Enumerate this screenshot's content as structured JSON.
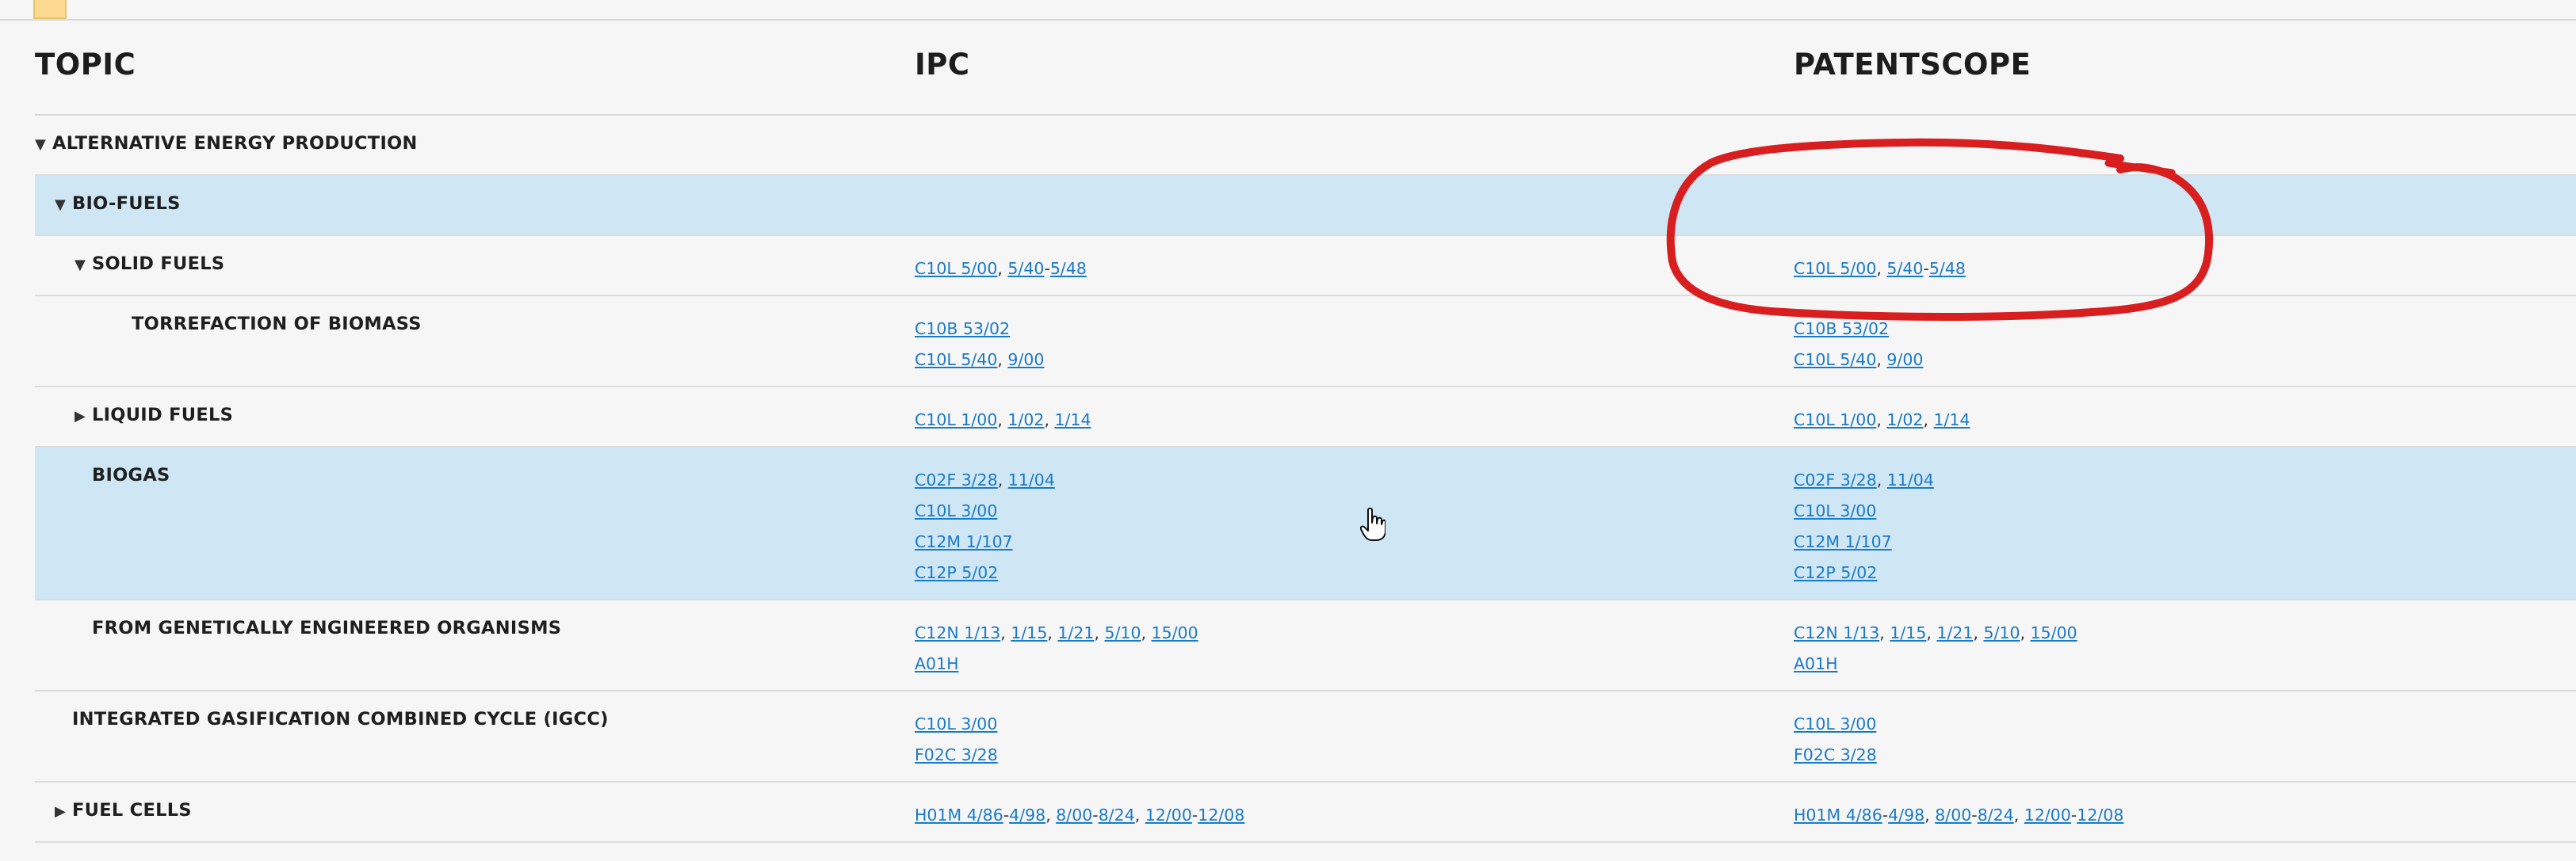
{
  "header": {
    "topic": "TOPIC",
    "ipc": "IPC",
    "patentscope": "PATENTSCOPE"
  },
  "rows": [
    {
      "topic": "ALTERNATIVE ENERGY PRODUCTION",
      "toggle": "▼",
      "level": 0,
      "highlight": false,
      "ipc": [],
      "patentscope": []
    },
    {
      "topic": "BIO-FUELS",
      "toggle": "▼",
      "level": 1,
      "highlight": true,
      "ipc": [],
      "patentscope": []
    },
    {
      "topic": "SOLID FUELS",
      "toggle": "▼",
      "level": 2,
      "highlight": false,
      "ipc": [
        [
          "C10L 5/00",
          ", ",
          "5/40",
          "-",
          "5/48"
        ]
      ],
      "patentscope": [
        [
          "C10L 5/00",
          ", ",
          "5/40",
          "-",
          "5/48"
        ]
      ]
    },
    {
      "topic": "TORREFACTION OF BIOMASS",
      "toggle": "",
      "level": 3,
      "highlight": false,
      "ipc": [
        [
          "C10B 53/02"
        ],
        [
          "C10L 5/40",
          ", ",
          "9/00"
        ]
      ],
      "patentscope": [
        [
          "C10B 53/02"
        ],
        [
          "C10L 5/40",
          ", ",
          "9/00"
        ]
      ]
    },
    {
      "topic": "LIQUID FUELS",
      "toggle": "▶",
      "level": 2,
      "highlight": false,
      "ipc": [
        [
          "C10L 1/00",
          ", ",
          "1/02",
          ", ",
          "1/14"
        ]
      ],
      "patentscope": [
        [
          "C10L 1/00",
          ", ",
          "1/02",
          ", ",
          "1/14"
        ]
      ]
    },
    {
      "topic": "BIOGAS",
      "toggle": "",
      "level": 2,
      "highlight": true,
      "ipc": [
        [
          "C02F 3/28",
          ", ",
          "11/04"
        ],
        [
          "C10L 3/00"
        ],
        [
          "C12M 1/107"
        ],
        [
          "C12P 5/02"
        ]
      ],
      "patentscope": [
        [
          "C02F 3/28",
          ", ",
          "11/04"
        ],
        [
          "C10L 3/00"
        ],
        [
          "C12M 1/107"
        ],
        [
          "C12P 5/02"
        ]
      ]
    },
    {
      "topic": "FROM GENETICALLY ENGINEERED ORGANISMS",
      "toggle": "",
      "level": 2,
      "highlight": false,
      "ipc": [
        [
          "C12N 1/13",
          ", ",
          "1/15",
          ", ",
          "1/21",
          ", ",
          "5/10",
          ", ",
          "15/00"
        ],
        [
          "A01H"
        ]
      ],
      "patentscope": [
        [
          "C12N 1/13",
          ", ",
          "1/15",
          ", ",
          "1/21",
          ", ",
          "5/10",
          ", ",
          "15/00"
        ],
        [
          "A01H"
        ]
      ]
    },
    {
      "topic": "INTEGRATED GASIFICATION COMBINED CYCLE (IGCC)",
      "toggle": "",
      "level": 1,
      "highlight": false,
      "ipc": [
        [
          "C10L 3/00"
        ],
        [
          "F02C 3/28"
        ]
      ],
      "patentscope": [
        [
          "C10L 3/00"
        ],
        [
          "F02C 3/28"
        ]
      ]
    },
    {
      "topic": "FUEL CELLS",
      "toggle": "▶",
      "level": 1,
      "highlight": false,
      "ipc": [
        [
          "H01M 4/86",
          "-",
          "4/98",
          ", ",
          "8/00",
          "-",
          "8/24",
          ", ",
          "12/00",
          "-",
          "12/08"
        ]
      ],
      "patentscope": [
        [
          "H01M 4/86",
          "-",
          "4/98",
          ", ",
          "8/00",
          "-",
          "8/24",
          ", ",
          "12/00",
          "-",
          "12/08"
        ]
      ]
    }
  ],
  "colors": {
    "link": "#1a7ac9",
    "highlight": "#cfe7f5",
    "annotation": "#d81e1e"
  }
}
